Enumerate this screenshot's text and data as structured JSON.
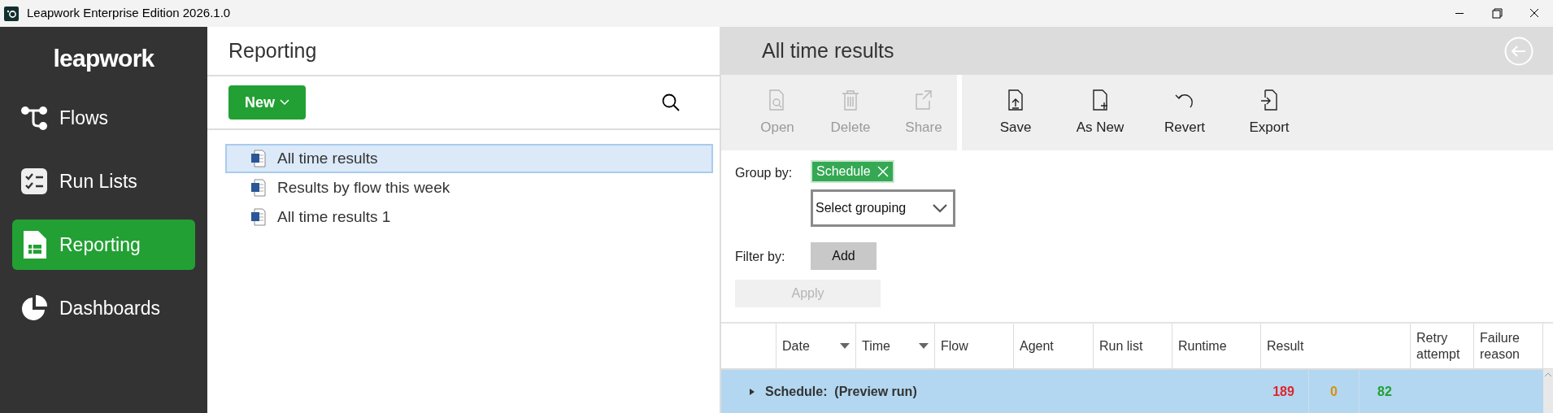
{
  "window": {
    "title": "Leapwork Enterprise Edition 2026.1.0"
  },
  "sidebar": {
    "logo": "leapwork",
    "items": [
      {
        "label": "Flows",
        "selected": false
      },
      {
        "label": "Run Lists",
        "selected": false
      },
      {
        "label": "Reporting",
        "selected": true
      },
      {
        "label": "Dashboards",
        "selected": false
      }
    ]
  },
  "reports_panel": {
    "title": "Reporting",
    "new_button": "New",
    "items": [
      {
        "label": "All time results",
        "selected": true
      },
      {
        "label": "Results by flow this week",
        "selected": false
      },
      {
        "label": "All time results 1",
        "selected": false
      }
    ]
  },
  "report": {
    "title": "All time results",
    "toolbar": [
      {
        "label": "Open",
        "disabled": true
      },
      {
        "label": "Delete",
        "disabled": true
      },
      {
        "label": "Share",
        "disabled": true
      },
      {
        "label": "Save",
        "disabled": false
      },
      {
        "label": "As New",
        "disabled": false
      },
      {
        "label": "Revert",
        "disabled": false
      },
      {
        "label": "Export",
        "disabled": false
      }
    ],
    "group_by_label": "Group by:",
    "group_chips": [
      "Schedule"
    ],
    "grouping_select": {
      "value": "Select grouping"
    },
    "filter_by_label": "Filter by:",
    "add_button": "Add",
    "apply_button": {
      "label": "Apply",
      "disabled": true
    },
    "table": {
      "columns": [
        {
          "label": "Date",
          "sortable": true
        },
        {
          "label": "Time",
          "sortable": true
        },
        {
          "label": "Flow",
          "sortable": false
        },
        {
          "label": "Agent",
          "sortable": false
        },
        {
          "label": "Run list",
          "sortable": false
        },
        {
          "label": "Runtime",
          "sortable": false
        },
        {
          "label": "Result",
          "sortable": false
        },
        {
          "label": "Retry attempt",
          "sortable": false
        },
        {
          "label": "Failure reason",
          "sortable": false
        }
      ],
      "groups": [
        {
          "label": "Schedule:  (Preview run)",
          "expanded": false,
          "counts": [
            {
              "value": "189",
              "color": "#e0242b"
            },
            {
              "value": "0",
              "color": "#d9900a"
            },
            {
              "value": "82",
              "color": "#22a034"
            }
          ]
        }
      ]
    }
  }
}
